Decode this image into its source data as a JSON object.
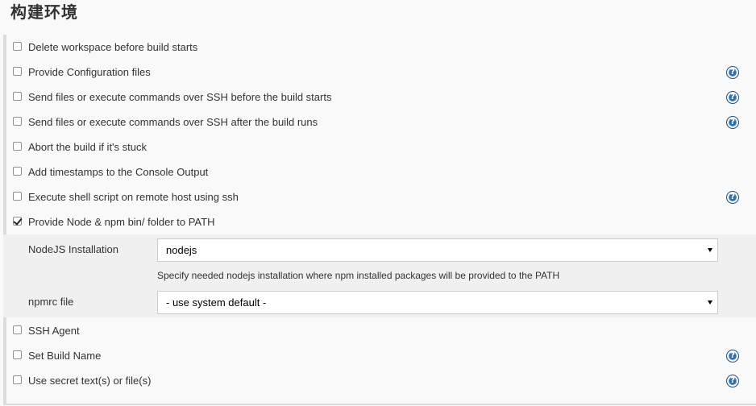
{
  "section": {
    "title": "构建环境"
  },
  "options": [
    {
      "label": "Delete workspace before build starts",
      "checked": false,
      "help": false
    },
    {
      "label": "Provide Configuration files",
      "checked": false,
      "help": true
    },
    {
      "label": "Send files or execute commands over SSH before the build starts",
      "checked": false,
      "help": true
    },
    {
      "label": "Send files or execute commands over SSH after the build runs",
      "checked": false,
      "help": true
    },
    {
      "label": "Abort the build if it's stuck",
      "checked": false,
      "help": false
    },
    {
      "label": "Add timestamps to the Console Output",
      "checked": false,
      "help": false
    },
    {
      "label": "Execute shell script on remote host using ssh",
      "checked": false,
      "help": true
    },
    {
      "label": "Provide Node & npm bin/ folder to PATH",
      "checked": true,
      "help": false
    },
    {
      "label": "SSH Agent",
      "checked": false,
      "help": false
    },
    {
      "label": "Set Build Name",
      "checked": false,
      "help": true
    },
    {
      "label": "Use secret text(s) or file(s)",
      "checked": false,
      "help": true
    }
  ],
  "node_config": {
    "nodejs_label": "NodeJS Installation",
    "nodejs_value": "nodejs",
    "nodejs_hint": "Specify needed nodejs installation where npm installed packages will be provided to the PATH",
    "npmrc_label": "npmrc file",
    "npmrc_value": "- use system default -"
  },
  "help_glyph": "?",
  "colors": {
    "page_bg": "#f9f9f9",
    "subpanel_bg": "#f0f0f0",
    "help_icon": "#2f6fa8"
  }
}
